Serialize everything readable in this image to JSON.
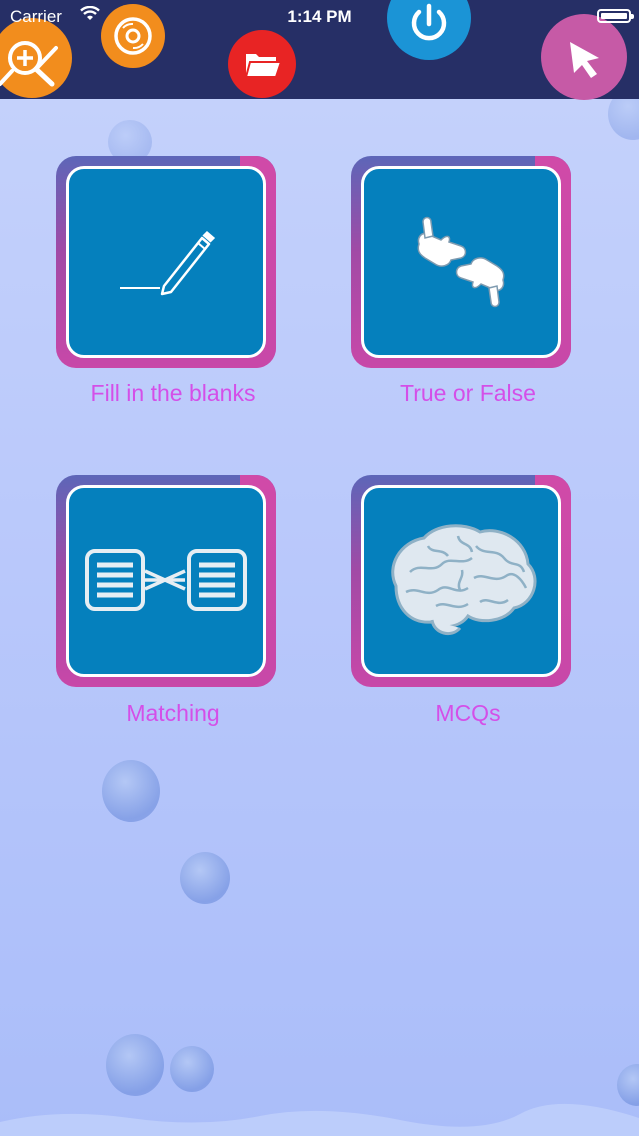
{
  "status_bar": {
    "carrier": "Carrier",
    "time": "1:14 PM"
  },
  "toolbar": {
    "buttons": [
      {
        "icon": "zoom-in-icon",
        "color": "#f28d1d"
      },
      {
        "icon": "disc-icon",
        "color": "#f28d1d"
      },
      {
        "icon": "folder-icon",
        "color": "#e82424"
      },
      {
        "icon": "power-icon",
        "color": "#1b94d6"
      },
      {
        "icon": "pointer-icon",
        "color": "#c65aa6"
      }
    ]
  },
  "menu": {
    "items": [
      {
        "label": "Fill in the blanks",
        "icon": "pencil-line-icon"
      },
      {
        "label": "True or False",
        "icon": "thumbs-up-down-icon"
      },
      {
        "label": "Matching",
        "icon": "matching-lists-icon"
      },
      {
        "label": "MCQs",
        "icon": "brain-icon"
      }
    ]
  },
  "colors": {
    "toolbar_bg": "#262f66",
    "tile_bg": "#0580bd",
    "label_color": "#d44fe8",
    "page_bg": "#b9c8fb"
  }
}
